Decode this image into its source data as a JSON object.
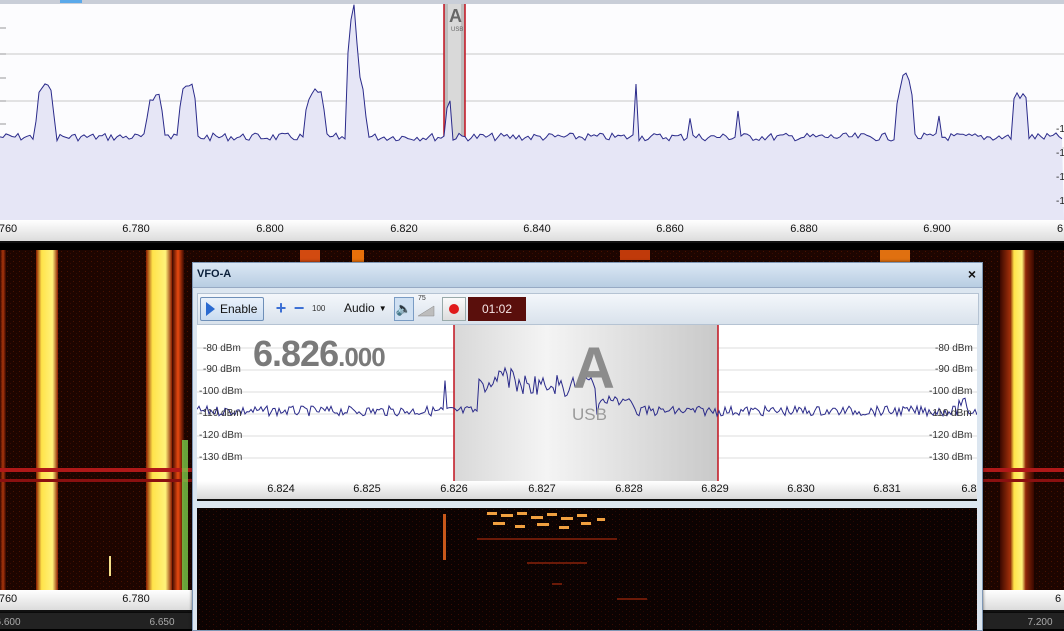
{
  "main_spectrum": {
    "vfo_marker_letter": "A",
    "vfo_marker_mode": "USB",
    "ruler_labels": [
      "760",
      "6.780",
      "6.800",
      "6.820",
      "6.840",
      "6.860",
      "6.880",
      "6.900",
      "6"
    ],
    "right_axis_labels": [
      "-1",
      "-1",
      "-1",
      "-1"
    ],
    "splitter_dots": "............"
  },
  "waterfall": {
    "bottom_ruler_labels": [
      "760",
      "6.780",
      "6"
    ],
    "bottom_scale_labels": [
      "6.600",
      "6.650",
      "7.200"
    ]
  },
  "vfo_window": {
    "title": "VFO-A",
    "close_glyph": "×",
    "toolbar": {
      "enable_label": "Enable",
      "step_label": "100",
      "audio_label": "Audio",
      "volume_label": "75",
      "timer": "01:02"
    },
    "frequency_main": "6.826",
    "frequency_small": ".000",
    "marker_letter": "A",
    "marker_mode": "USB",
    "db_labels_left": [
      "-80 dBm",
      "-90 dBm",
      "-100 dBm",
      "-110 dBm",
      "-120 dBm",
      "-130 dBm"
    ],
    "db_labels_right": [
      "-80 dBm",
      "-90 dBm",
      "-100 dBm",
      "-110 dBm",
      "-120 dBm",
      "-130 dBm"
    ],
    "freq_axis_labels": [
      "6.824",
      "6.825",
      "6.826",
      "6.827",
      "6.828",
      "6.829",
      "6.830",
      "6.831",
      "6.8"
    ],
    "splitter_dots": "............"
  },
  "colors": {
    "trace": "#2a2a8a",
    "passband": "#c1121f",
    "waterfall_hot": "#ffe34a",
    "waterfall_warm": "#e0400a",
    "timer_bg": "#5a0f0c"
  }
}
